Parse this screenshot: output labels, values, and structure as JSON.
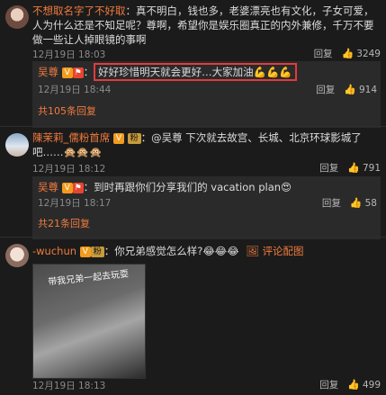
{
  "comments": [
    {
      "user": "不想取名字了不好取",
      "text": "真不明白，钱也多，老婆漂亮也有文化，子女可爱，人为什么还是不知足呢？尊啊，希望你是娱乐圈真正的内外兼修，千万不要做一些让人掉眼镜的事啊",
      "time": "12月19日 18:03",
      "reply_label": "回复",
      "likes": "3249",
      "replies": [
        {
          "user": "吴尊",
          "text": "好好珍惜明天就会更好…大家加油💪💪💪",
          "time": "12月19日 18:44",
          "reply_label": "回复",
          "likes": "914"
        }
      ],
      "more_label": "共105条回复"
    },
    {
      "user": "陳茉莉_儒粉首席",
      "text": "@吴尊 下次就去故宫、长城、北京环球影城了吧……🙊🙊🙊",
      "time": "12月19日 18:12",
      "reply_label": "回复",
      "likes": "791",
      "replies": [
        {
          "user": "吴尊",
          "text": "到时再跟你们分享我们的 vacation plan😍",
          "time": "12月19日 18:17",
          "reply_label": "回复",
          "likes": "58"
        }
      ],
      "more_label": "共21条回复"
    },
    {
      "user": "-wuchun",
      "text": "你兄弟感觉怎么样?😂😂😂",
      "image_link": "评论配图",
      "image_sign": "带我兄弟一起去玩耍",
      "time": "12月19日 18:13",
      "reply_label": "回复",
      "likes": "499"
    }
  ],
  "icons": {
    "like": "thumb-up-icon",
    "verified": "v-badge-icon",
    "image": "image-icon"
  },
  "colors": {
    "username": "#f07b3f",
    "highlight_border": "#e23b3b",
    "background": "#1b1b1b"
  }
}
